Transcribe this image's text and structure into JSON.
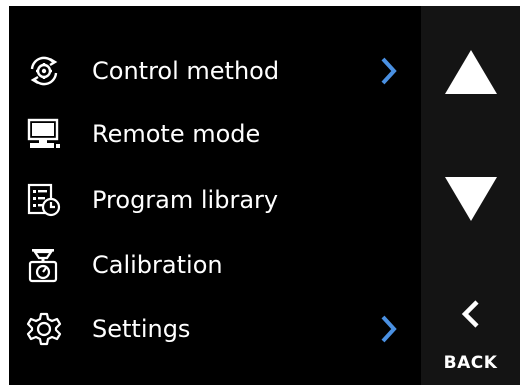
{
  "menu": {
    "items": [
      {
        "label": "Control method",
        "icon": "gear-cycle-icon",
        "has_submenu": true
      },
      {
        "label": "Remote mode",
        "icon": "computer-icon",
        "has_submenu": false
      },
      {
        "label": "Program library",
        "icon": "list-clock-icon",
        "has_submenu": false
      },
      {
        "label": "Calibration",
        "icon": "scale-icon",
        "has_submenu": false
      },
      {
        "label": "Settings",
        "icon": "gear-icon",
        "has_submenu": true
      }
    ]
  },
  "nav": {
    "up_icon": "triangle-up-icon",
    "down_icon": "triangle-down-icon",
    "back_icon": "chevron-left-icon",
    "back_label": "BACK"
  },
  "colors": {
    "background": "#000000",
    "side_panel": "#141414",
    "text": "#ffffff",
    "chevron_accent": "#4a90e2"
  }
}
